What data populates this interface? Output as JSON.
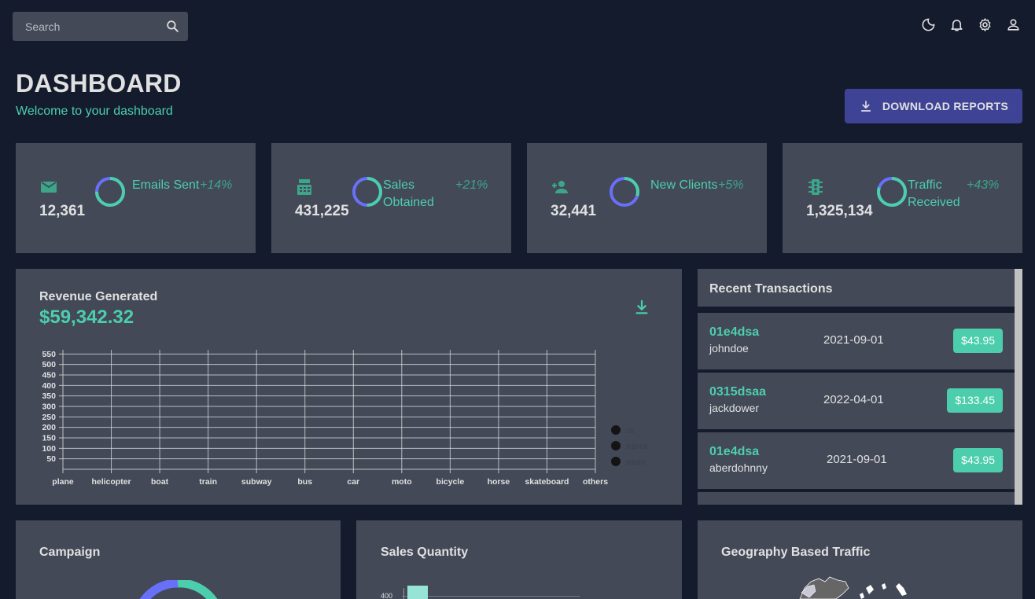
{
  "search": {
    "placeholder": "Search"
  },
  "topbar": {
    "icons": [
      "dark-mode-icon",
      "notifications-icon",
      "settings-icon",
      "person-icon"
    ]
  },
  "header": {
    "title": "DASHBOARD",
    "subtitle": "Welcome to your dashboard"
  },
  "download_button": {
    "label": "DOWNLOAD REPORTS"
  },
  "stats": [
    {
      "icon": "email-icon",
      "value": "12,361",
      "label": "Emails Sent",
      "delta": "+14%",
      "progress": 0.75
    },
    {
      "icon": "point-of-sale-icon",
      "value": "431,225",
      "label": "Sales Obtained",
      "delta": "+21%",
      "progress": 0.5
    },
    {
      "icon": "person-add-icon",
      "value": "32,441",
      "label": "New Clients",
      "delta": "+5%",
      "progress": 0.3
    },
    {
      "icon": "traffic-icon",
      "value": "1,325,134",
      "label": "Traffic Received",
      "delta": "+43%",
      "progress": 0.8
    }
  ],
  "revenue": {
    "title": "Revenue Generated",
    "value": "$59,342.32"
  },
  "chart_data": {
    "type": "line",
    "categories": [
      "plane",
      "helicopter",
      "boat",
      "train",
      "subway",
      "bus",
      "car",
      "moto",
      "bicycle",
      "horse",
      "skateboard",
      "others"
    ],
    "yticks": [
      50,
      100,
      150,
      200,
      250,
      300,
      350,
      400,
      450,
      500,
      550
    ],
    "ylim": [
      0,
      570
    ],
    "grid": true,
    "legend_position": "right",
    "series": [
      {
        "name": "us",
        "values": []
      },
      {
        "name": "france",
        "values": []
      },
      {
        "name": "japan",
        "values": []
      }
    ],
    "colors": {
      "axis": "#c2c2c2",
      "grid": "#e0e0e0",
      "legend_dot": "#141414",
      "legend_text": "#3a3f4c"
    }
  },
  "transactions": {
    "title": "Recent Transactions",
    "items": [
      {
        "txId": "01e4dsa",
        "user": "johndoe",
        "date": "2021-09-01",
        "cost": "$43.95"
      },
      {
        "txId": "0315dsaa",
        "user": "jackdower",
        "date": "2022-04-01",
        "cost": "$133.45"
      },
      {
        "txId": "01e4dsa",
        "user": "aberdohnny",
        "date": "2021-09-01",
        "cost": "$43.95"
      }
    ]
  },
  "campaign": {
    "title": "Campaign"
  },
  "sales_quantity": {
    "title": "Sales Quantity",
    "tick_label": "400"
  },
  "geography": {
    "title": "Geography Based Traffic"
  },
  "colors": {
    "background": "#141b2d",
    "panel": "#434957",
    "accent_green": "#4cceac",
    "accent_blue": "#6870fa",
    "button": "#3e4396"
  }
}
